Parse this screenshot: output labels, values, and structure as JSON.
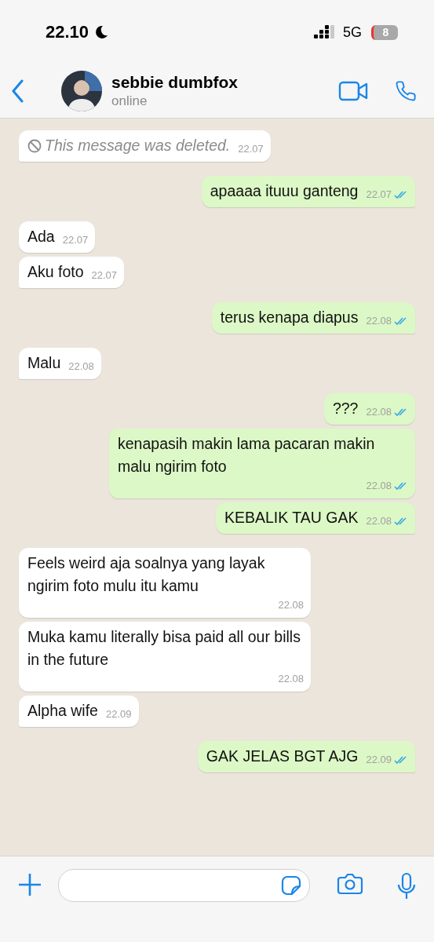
{
  "status_bar": {
    "time": "22.10",
    "network": "5G",
    "battery": "8"
  },
  "header": {
    "name": "sebbie dumbfox",
    "status": "online"
  },
  "messages": [
    {
      "kind": "deleted",
      "outgoing": false,
      "text": "This message was deleted.",
      "time": "22.07"
    },
    {
      "kind": "text",
      "outgoing": true,
      "text": "apaaaa ituuu ganteng",
      "time": "22.07",
      "read": true
    },
    {
      "kind": "text",
      "outgoing": false,
      "text": "Ada",
      "time": "22.07"
    },
    {
      "kind": "text",
      "outgoing": false,
      "text": "Aku foto",
      "time": "22.07"
    },
    {
      "kind": "text",
      "outgoing": true,
      "text": "terus kenapa diapus",
      "time": "22.08",
      "read": true
    },
    {
      "kind": "text",
      "outgoing": false,
      "text": "Malu",
      "time": "22.08"
    },
    {
      "kind": "text",
      "outgoing": true,
      "text": "???",
      "time": "22.08",
      "read": true
    },
    {
      "kind": "text",
      "outgoing": true,
      "text": "kenapasih makin lama pacaran makin malu ngirim foto",
      "time": "22.08",
      "read": true
    },
    {
      "kind": "text",
      "outgoing": true,
      "text": "KEBALIK TAU GAK",
      "time": "22.08",
      "read": true
    },
    {
      "kind": "text",
      "outgoing": false,
      "text": "Feels weird aja soalnya yang layak ngirim foto mulu itu kamu",
      "time": "22.08"
    },
    {
      "kind": "text",
      "outgoing": false,
      "text": "Muka kamu literally bisa paid all our bills in the future",
      "time": "22.08"
    },
    {
      "kind": "text",
      "outgoing": false,
      "text": "Alpha wife",
      "time": "22.09"
    },
    {
      "kind": "text",
      "outgoing": true,
      "text": "GAK JELAS BGT AJG",
      "time": "22.09",
      "read": true
    }
  ]
}
